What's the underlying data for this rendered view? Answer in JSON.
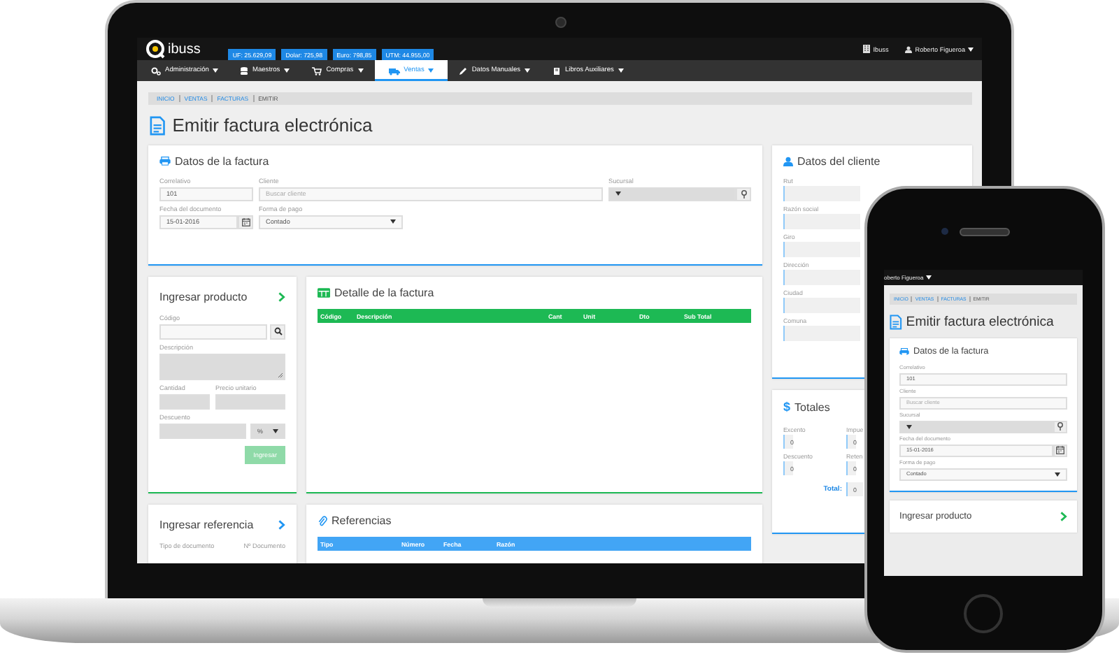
{
  "header": {
    "logo": "ibuss",
    "indicators": [
      "UF: 25.629,09",
      "Dolar: 725,98",
      "Euro: 798,85",
      "UTM: 44.955,00"
    ],
    "company": "Ibuss",
    "user": "Roberto Figueroa"
  },
  "menu": [
    {
      "label": "Administración",
      "selected": false
    },
    {
      "label": "Maestros",
      "selected": false
    },
    {
      "label": "Compras",
      "selected": false
    },
    {
      "label": "Ventas",
      "selected": true
    },
    {
      "label": "Datos Manuales",
      "selected": false
    },
    {
      "label": "Libros Auxiliares",
      "selected": false
    }
  ],
  "breadcrumb": [
    {
      "label": "INICIO",
      "selected": false
    },
    {
      "label": "VENTAS",
      "selected": false
    },
    {
      "label": "FACTURAS",
      "selected": false
    },
    {
      "label": "EMITIR",
      "selected": true
    }
  ],
  "page_title": "Emitir factura electrónica",
  "invoice_data": {
    "title": "Datos de la factura",
    "fields": [
      {
        "kind": "text",
        "label": "Correlativo",
        "value": "101",
        "disabled": false
      },
      {
        "kind": "text",
        "label": "Cliente",
        "placeholder": "Buscar cliente",
        "disabled": false
      },
      {
        "kind": "locselect",
        "label": "Sucursal",
        "disabled": true
      },
      {
        "kind": "date",
        "label": "Fecha del documento",
        "value": "15-01-2016",
        "disabled": false
      },
      {
        "kind": "select",
        "label": "Forma de pago",
        "value": "Contado",
        "disabled": false
      }
    ]
  },
  "product_entry": {
    "title": "Ingresar producto",
    "fields": [
      {
        "kind": "search",
        "label": "Código",
        "disabled": false
      },
      {
        "kind": "textarea",
        "label": "Descripción",
        "disabled": true
      },
      {
        "kind": "text",
        "label": "Cantidad",
        "disabled": true
      },
      {
        "kind": "text",
        "label": "Precio unitario",
        "disabled": true
      },
      {
        "kind": "discount",
        "label": "Descuento",
        "unit": "%",
        "disabled": true
      }
    ],
    "button": {
      "label": "Ingresar",
      "disabled": true
    }
  },
  "invoice_detail": {
    "title": "Detalle de la factura",
    "columns": [
      "Código",
      "Descripción",
      "Cant",
      "Unit",
      "Dto",
      "Sub Total"
    ]
  },
  "reference_entry": {
    "title": "Ingresar referencia",
    "labels": [
      "Tipo de documento",
      "Nº Documento"
    ]
  },
  "references": {
    "title": "Referencias",
    "columns": [
      "Tipo",
      "Número",
      "Fecha",
      "Razón"
    ]
  },
  "client_data": {
    "title": "Datos del cliente",
    "fields": [
      "Rut",
      "Razón social",
      "Giro",
      "Dirección",
      "Ciudad",
      "Comuna"
    ]
  },
  "totals": {
    "icon": "$",
    "title": "Totales",
    "fields": [
      {
        "label": "Excento",
        "value": "0"
      },
      {
        "label": "Impue",
        "value": "0"
      },
      {
        "label": "Descuento",
        "value": "0"
      },
      {
        "label": "Reten",
        "value": "0"
      }
    ],
    "total": {
      "label": "Total:",
      "value": "0"
    }
  },
  "phone": {
    "user": "oberto Figueroa",
    "breadcrumb": [
      {
        "label": "INICIO",
        "selected": false
      },
      {
        "label": "VENTAS",
        "selected": false
      },
      {
        "label": "FACTURAS",
        "selected": false
      },
      {
        "label": "EMITIR",
        "selected": true
      }
    ],
    "page_title": "Emitir factura electrónica",
    "invoice_data": {
      "title": "Datos de la factura",
      "fields": [
        {
          "kind": "text",
          "label": "Correlativo",
          "value": "101",
          "disabled": false
        },
        {
          "kind": "text",
          "label": "Cliente",
          "placeholder": "Buscar cliente",
          "disabled": false
        },
        {
          "kind": "locselect",
          "label": "Sucursal",
          "disabled": true
        },
        {
          "kind": "date",
          "label": "Fecha del documento",
          "value": "15-01-2016",
          "disabled": false
        },
        {
          "kind": "select",
          "label": "Forma de pago",
          "value": "Contado",
          "disabled": false
        }
      ]
    },
    "next_card": {
      "title": "Ingresar producto"
    }
  }
}
